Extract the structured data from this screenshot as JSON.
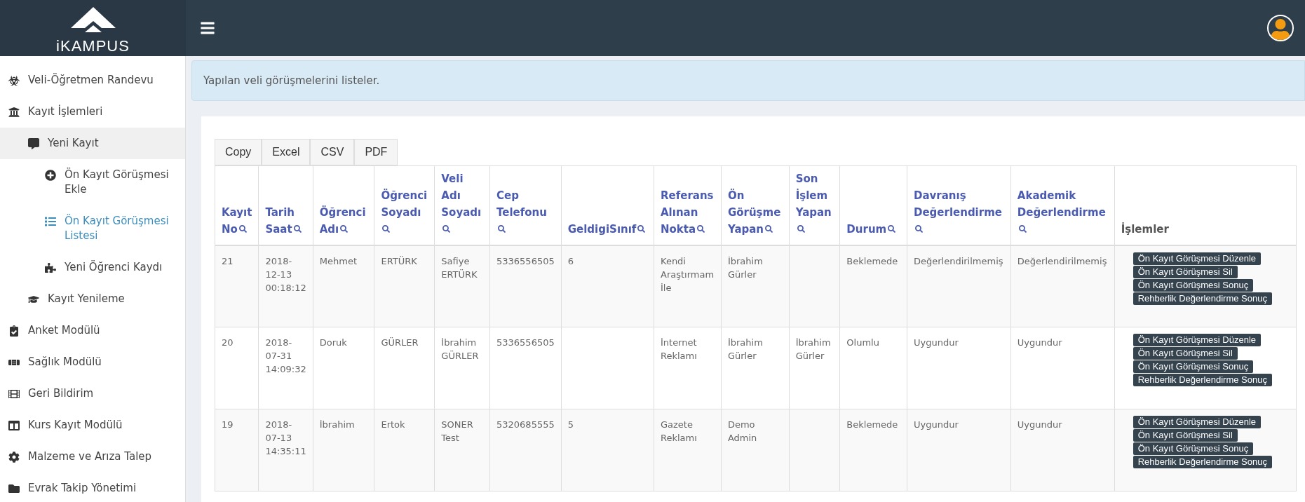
{
  "header": {
    "logo_text": "iKAMPUS"
  },
  "sidebar": {
    "items": [
      {
        "label": "Veli-Öğretmen Randevu",
        "selected": false,
        "highlighted": false
      },
      {
        "label": "Kayıt İşlemleri",
        "selected": false,
        "highlighted": false,
        "children": [
          {
            "label": "Yeni Kayıt",
            "selected": false,
            "highlighted": true,
            "children": [
              {
                "label": "Ön Kayıt Görüşmesi Ekle",
                "selected": false,
                "highlighted": false
              },
              {
                "label": "Ön Kayıt Görüşmesi Listesi",
                "selected": true,
                "highlighted": false
              },
              {
                "label": "Yeni Öğrenci Kaydı",
                "selected": false,
                "highlighted": false
              }
            ]
          },
          {
            "label": "Kayıt Yenileme",
            "selected": false,
            "highlighted": false
          }
        ]
      },
      {
        "label": "Anket Modülü",
        "selected": false,
        "highlighted": false
      },
      {
        "label": "Sağlık Modülü",
        "selected": false,
        "highlighted": false
      },
      {
        "label": "Geri Bildirim",
        "selected": false,
        "highlighted": false
      },
      {
        "label": "Kurs Kayıt Modülü",
        "selected": false,
        "highlighted": false
      },
      {
        "label": "Malzeme ve Arıza Talep",
        "selected": false,
        "highlighted": false
      },
      {
        "label": "Evrak Takip Yönetimi",
        "selected": false,
        "highlighted": false
      }
    ]
  },
  "info": "Yapılan veli görüşmelerini listeler.",
  "export_buttons": [
    "Copy",
    "Excel",
    "CSV",
    "PDF"
  ],
  "table": {
    "columns": [
      {
        "label": "Kayıt No",
        "searchable": true
      },
      {
        "label": "Tarih Saat",
        "searchable": true
      },
      {
        "label": "Öğrenci Adı",
        "searchable": true
      },
      {
        "label": "Öğrenci Soyadı",
        "searchable": true
      },
      {
        "label": "Veli Adı Soyadı",
        "searchable": true
      },
      {
        "label": "Cep Telefonu",
        "searchable": true
      },
      {
        "label": "GeldigiSınıf",
        "searchable": true
      },
      {
        "label": "Referans Alınan Nokta",
        "searchable": true
      },
      {
        "label": "Ön Görüşme Yapan",
        "searchable": true
      },
      {
        "label": "Son İşlem Yapan",
        "searchable": true
      },
      {
        "label": "Durum",
        "searchable": true
      },
      {
        "label": "Davranış Değerlendirme",
        "searchable": true
      },
      {
        "label": "Akademik Değerlendirme",
        "searchable": true
      },
      {
        "label": "İşlemler",
        "searchable": false
      }
    ],
    "rows": [
      {
        "cells": [
          "21",
          "2018-12-13 00:18:12",
          "Mehmet",
          "ERTÜRK",
          "Safiye ERTÜRK",
          "5336556505",
          "6",
          "Kendi Araştırmam İle",
          "İbrahim Gürler",
          "",
          "Beklemede",
          "Değerlendirilmemiş",
          "Değerlendirilmemiş"
        ],
        "actions": [
          "Ön Kayıt Görüşmesi Düzenle",
          "Ön Kayıt Görüşmesi Sil",
          "Ön Kayıt Görüşmesi Sonuç",
          "Rehberlik Değerlendirme Sonuç"
        ]
      },
      {
        "cells": [
          "20",
          "2018-07-31 14:09:32",
          "Doruk",
          "GÜRLER",
          "İbrahim GÜRLER",
          "5336556505",
          "",
          "İnternet Reklamı",
          "İbrahim Gürler",
          "İbrahim Gürler",
          "Olumlu",
          "Uygundur",
          "Uygundur"
        ],
        "actions": [
          "Ön Kayıt Görüşmesi Düzenle",
          "Ön Kayıt Görüşmesi Sil",
          "Ön Kayıt Görüşmesi Sonuç",
          "Rehberlik Değerlendirme Sonuç"
        ]
      },
      {
        "cells": [
          "19",
          "2018-07-13 14:35:11",
          "İbrahim",
          "Ertok",
          "SONER Test",
          "5320685555",
          "5",
          "Gazete Reklamı",
          "Demo Admin",
          "",
          "Beklemede",
          "Uygundur",
          "Uygundur"
        ],
        "actions": [
          "Ön Kayıt Görüşmesi Düzenle",
          "Ön Kayıt Görüşmesi Sil",
          "Ön Kayıt Görüşmesi Sonuç",
          "Rehberlik Değerlendirme Sonuç"
        ]
      }
    ]
  }
}
